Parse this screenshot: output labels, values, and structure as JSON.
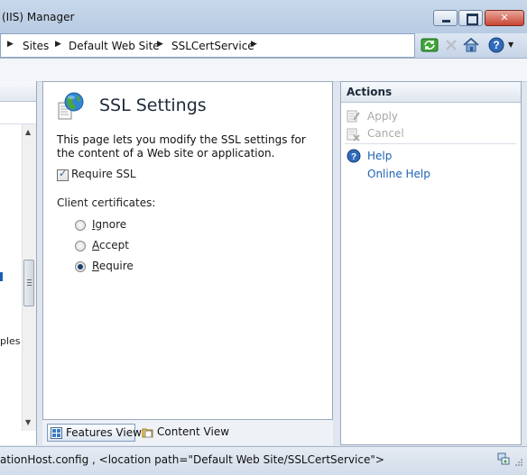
{
  "window": {
    "title": "(IIS) Manager"
  },
  "breadcrumbs": [
    "Sites",
    "Default Web Site",
    "SSLCertService"
  ],
  "left_pane": {
    "partial_text": "ples"
  },
  "page": {
    "title": "SSL Settings",
    "description": "This page lets you modify the SSL settings for the content of a Web site or application.",
    "require_ssl_label": "Require SSL",
    "require_ssl_checked": true,
    "client_certificates_label": "Client certificates:",
    "options": [
      {
        "label": "Ignore",
        "selected": false
      },
      {
        "label": "Accept",
        "selected": false
      },
      {
        "label": "Require",
        "selected": true
      }
    ]
  },
  "view_tabs": [
    {
      "label": "Features View",
      "active": true
    },
    {
      "label": "Content View",
      "active": false
    }
  ],
  "actions": {
    "header": "Actions",
    "items": [
      {
        "label": "Apply",
        "enabled": false,
        "icon": "apply-icon"
      },
      {
        "label": "Cancel",
        "enabled": false,
        "icon": "cancel-icon"
      },
      {
        "label": "Help",
        "enabled": true,
        "icon": "help-icon"
      },
      {
        "label": "Online Help",
        "enabled": true,
        "icon": ""
      }
    ]
  },
  "status": {
    "text": "ationHost.config , <location path=\"Default Web Site/SSLCertService\">"
  },
  "colors": {
    "link": "#1f62b3",
    "disabled": "#a8a8a8",
    "accent": "#1b3f6a"
  }
}
